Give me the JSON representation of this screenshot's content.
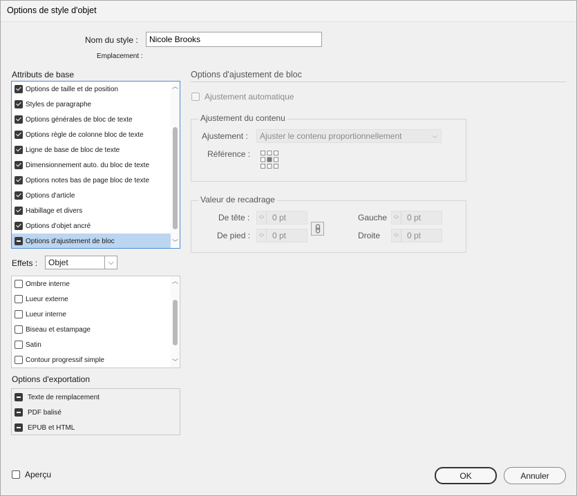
{
  "window": {
    "title": "Options de style d'objet"
  },
  "style_name": {
    "label": "Nom du style :",
    "value": "Nicole Brooks"
  },
  "location": {
    "label": "Emplacement :"
  },
  "base_attributes": {
    "title": "Attributs de base",
    "items": [
      {
        "label": "Options de taille et de position",
        "state": "checked"
      },
      {
        "label": "Styles de paragraphe",
        "state": "checked"
      },
      {
        "label": "Options générales de bloc de texte",
        "state": "checked"
      },
      {
        "label": "Options règle de colonne bloc de texte",
        "state": "checked"
      },
      {
        "label": "Ligne de base de bloc de texte",
        "state": "checked"
      },
      {
        "label": "Dimensionnement auto. du bloc de texte",
        "state": "checked"
      },
      {
        "label": "Options notes bas de page bloc de texte",
        "state": "checked"
      },
      {
        "label": "Options d'article",
        "state": "checked"
      },
      {
        "label": "Habillage et divers",
        "state": "checked"
      },
      {
        "label": "Options d'objet ancré",
        "state": "checked"
      },
      {
        "label": "Options d'ajustement de bloc",
        "state": "mixed"
      }
    ]
  },
  "effects": {
    "label": "Effets :",
    "selected": "Objet",
    "items": [
      {
        "label": "Ombre interne",
        "state": "empty"
      },
      {
        "label": "Lueur externe",
        "state": "empty"
      },
      {
        "label": "Lueur interne",
        "state": "empty"
      },
      {
        "label": "Biseau et estampage",
        "state": "empty"
      },
      {
        "label": "Satin",
        "state": "empty"
      },
      {
        "label": "Contour progressif simple",
        "state": "empty"
      }
    ]
  },
  "export_options": {
    "title": "Options d'exportation",
    "items": [
      {
        "label": "Texte de remplacement",
        "state": "mixed"
      },
      {
        "label": "PDF balisé",
        "state": "mixed"
      },
      {
        "label": "EPUB et HTML",
        "state": "mixed"
      }
    ]
  },
  "panel": {
    "title": "Options d'ajustement de bloc",
    "auto_fit": {
      "label": "Ajustement automatique"
    },
    "content_fitting": {
      "title": "Ajustement du contenu",
      "fitting_label": "Ajustement :",
      "fitting_value": "Ajuster le contenu proportionnellement",
      "reference_label": "Référence :"
    },
    "crop": {
      "title": "Valeur de recadrage",
      "top": {
        "label": "De tête :",
        "value": "0 pt"
      },
      "bottom": {
        "label": "De pied :",
        "value": "0 pt"
      },
      "left": {
        "label": "Gauche",
        "value": "0 pt"
      },
      "right": {
        "label": "Droite",
        "value": "0 pt"
      }
    }
  },
  "preview": {
    "label": "Aperçu"
  },
  "buttons": {
    "ok": "OK",
    "cancel": "Annuler"
  }
}
